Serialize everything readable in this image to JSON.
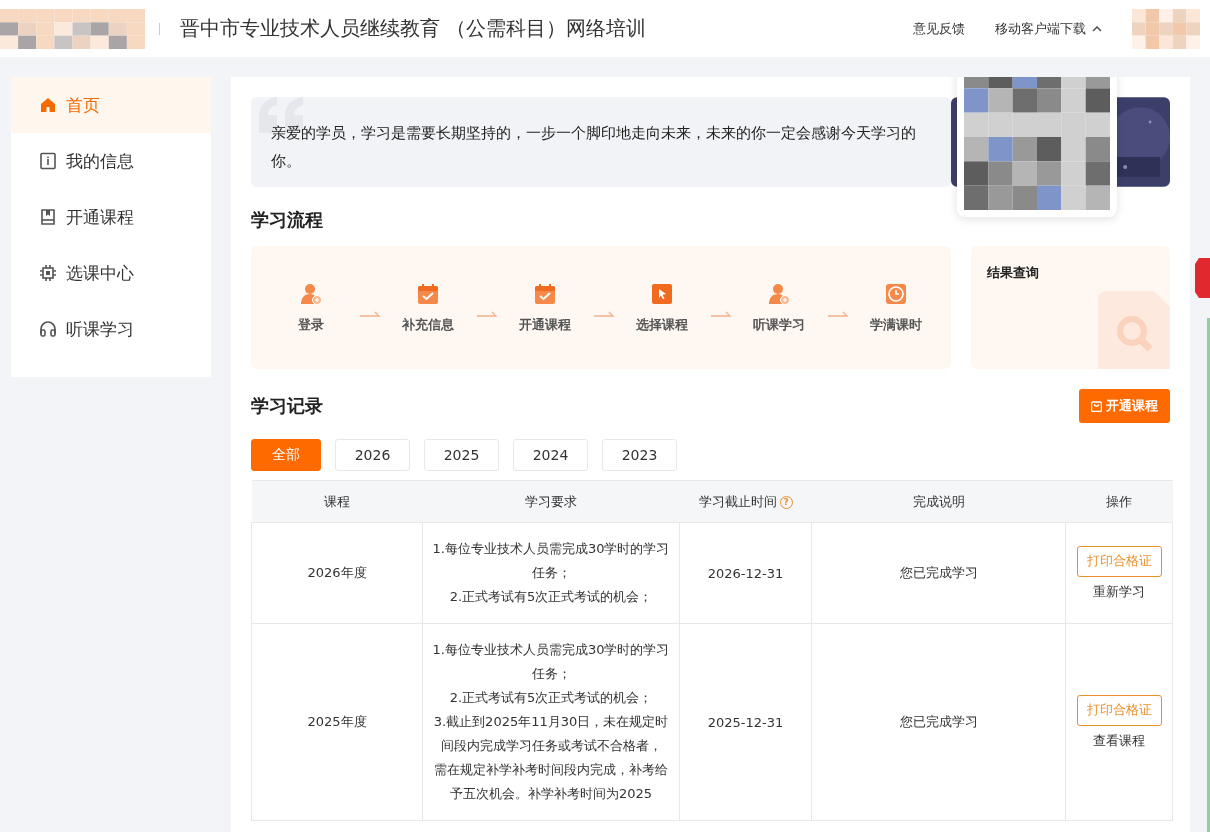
{
  "header": {
    "title": "晋中市专业技术人员继续教育 （公需科目）网络培训",
    "links": [
      {
        "label": "意见反馈",
        "kind": "link"
      },
      {
        "label": "移动客户端下载",
        "kind": "dropdown",
        "expanded": true
      }
    ]
  },
  "sidebar": {
    "items": [
      {
        "label": "首页",
        "selected": true
      },
      {
        "label": "我的信息",
        "selected": false
      },
      {
        "label": "开通课程",
        "selected": false
      },
      {
        "label": "选课中心",
        "selected": false
      },
      {
        "label": "听课学习",
        "selected": false
      }
    ]
  },
  "banner": {
    "text": "亲爱的学员，学习是需要长期坚持的，一步一个脚印地走向未来，未来的你一定会感谢今天学习的你。"
  },
  "process": {
    "title": "学习流程",
    "steps": [
      {
        "label": "登录"
      },
      {
        "label": "补充信息"
      },
      {
        "label": "开通课程"
      },
      {
        "label": "选择课程"
      },
      {
        "label": "听课学习"
      },
      {
        "label": "学满课时"
      }
    ],
    "result": {
      "title": "结果查询"
    }
  },
  "records": {
    "title": "学习记录",
    "open_button": "开通课程",
    "filters": [
      {
        "label": "全部",
        "selected": true
      },
      {
        "label": "2026",
        "selected": false
      },
      {
        "label": "2025",
        "selected": false
      },
      {
        "label": "2024",
        "selected": false
      },
      {
        "label": "2023",
        "selected": false
      }
    ],
    "table": {
      "columns": [
        "课程",
        "学习要求",
        "学习截止时间",
        "完成说明",
        "操作"
      ],
      "help_mark": "?",
      "rows": [
        {
          "course": "2026年度",
          "requirements": [
            "1.每位专业技术人员需完成30学时的学习任务；",
            "2.正式考试有5次正式考试的机会；"
          ],
          "deadline": "2026-12-31",
          "status": "您已完成学习",
          "actions": [
            "打印合格证",
            "重新学习"
          ]
        },
        {
          "course": "2025年度",
          "requirements": [
            "1.每位专业技术人员需完成30学时的学习任务；",
            "2.正式考试有5次正式考试的机会；",
            "3.截止到2025年11月30日，未在规定时间段内完成学习任务或考试不合格者，",
            "需在规定补学补考时间段内完成，补考给予五次机会。补学补考时间为2025"
          ],
          "deadline": "2025-12-31",
          "status": "您已完成学习",
          "actions": [
            "打印合格证",
            "查看课程"
          ]
        }
      ]
    }
  }
}
